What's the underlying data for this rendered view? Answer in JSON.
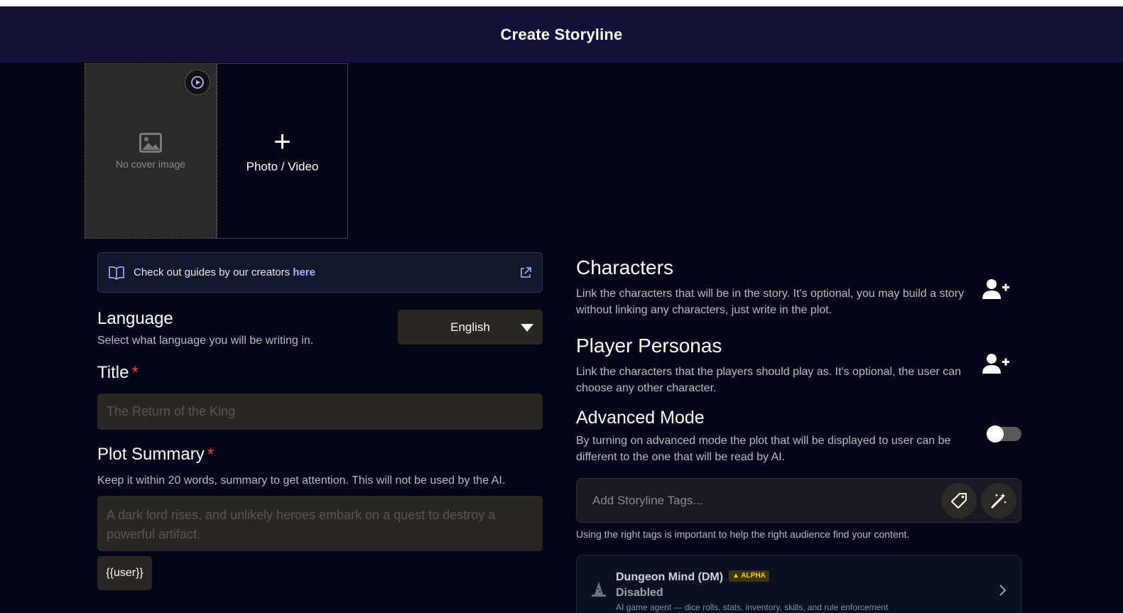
{
  "header": {
    "title": "Create Storyline"
  },
  "media": {
    "no_cover_label": "No cover image",
    "add_label": "Photo / Video",
    "add_symbol": "+"
  },
  "guide": {
    "text": "Check out guides by our creators ",
    "link": "here"
  },
  "language": {
    "title": "Language",
    "description": "Select what language you will be writing in.",
    "selected": "English"
  },
  "title_field": {
    "label": "Title",
    "required_mark": "*",
    "placeholder": "The Return of the King"
  },
  "plot_summary": {
    "label": "Plot Summary",
    "required_mark": "*",
    "description": "Keep it within 20 words, summary to get attention. This will not be used by the AI.",
    "placeholder": "A dark lord rises, and unlikely heroes embark on a quest to destroy a powerful artifact.",
    "user_chip": "{{user}}"
  },
  "characters": {
    "title": "Characters",
    "description": "Link the characters that will be in the story. It's optional, you may build a story without linking any characters, just write in the plot."
  },
  "player_personas": {
    "title": "Player Personas",
    "description": "Link the characters that the players should play as. It's optional, the user can choose any other character."
  },
  "advanced_mode": {
    "title": "Advanced Mode",
    "description": "By turning on advanced mode the plot that will be displayed to user can be different to the one that will be read by AI."
  },
  "tags": {
    "placeholder": "Add Storyline Tags...",
    "note": "Using the right tags is important to help the right audience find your content."
  },
  "dungeon_mind": {
    "name": "Dungeon Mind (DM)",
    "badge": "ALPHA",
    "status": "Disabled",
    "subtitle": "AI game agent — dice rolls, stats, inventory, skills, and rule enforcement"
  }
}
